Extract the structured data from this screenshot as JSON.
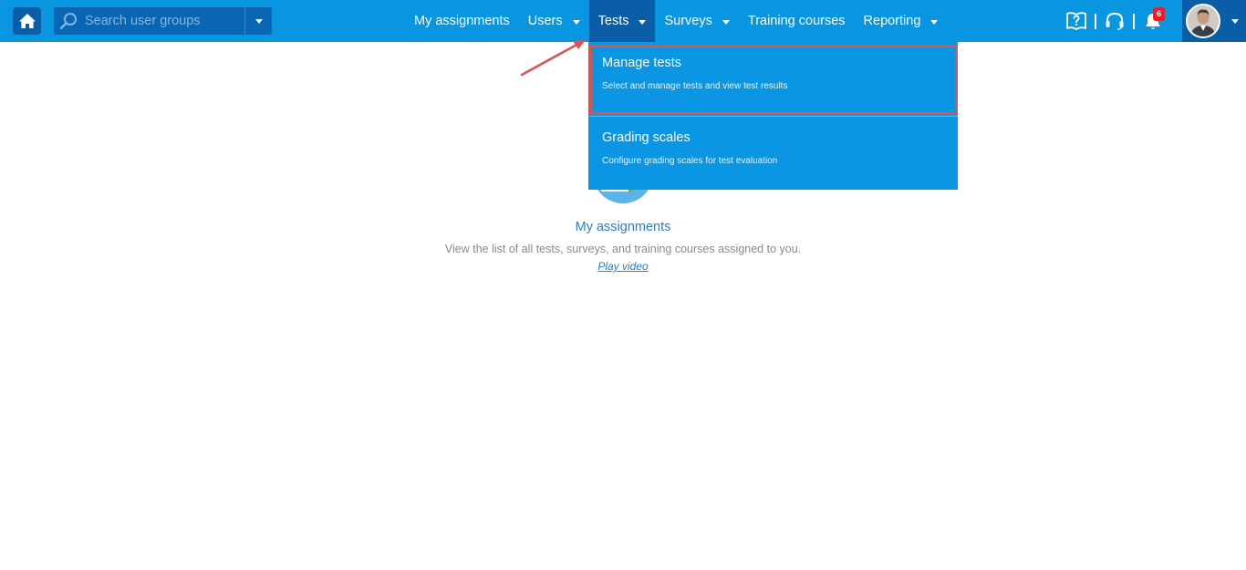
{
  "header": {
    "search": {
      "placeholder": "Search user groups"
    },
    "nav": {
      "my_assignments": "My assignments",
      "users": "Users",
      "tests": "Tests",
      "surveys": "Surveys",
      "training_courses": "Training courses",
      "reporting": "Reporting"
    },
    "notifications_count": "6",
    "icons": {
      "home": "home-icon",
      "search": "search-icon",
      "help": "help-book-icon",
      "support": "headset-icon",
      "notifications": "bell-icon",
      "avatar": "user-avatar"
    }
  },
  "dropdown": {
    "items": [
      {
        "title": "Manage tests",
        "subtitle": "Select and manage tests and view test results"
      },
      {
        "title": "Grading scales",
        "subtitle": "Configure grading scales for test evaluation"
      }
    ]
  },
  "main": {
    "title": "My assignments",
    "description": "View the list of all tests, surveys, and training courses assigned to you.",
    "video_link": "Play video"
  },
  "colors": {
    "topbar": "#0896e0",
    "active_nav": "#0a5ea8",
    "dropdown": "#0a96e2",
    "highlight": "#d9534f",
    "badge": "#e81f2a",
    "link": "#2d7fc0"
  }
}
